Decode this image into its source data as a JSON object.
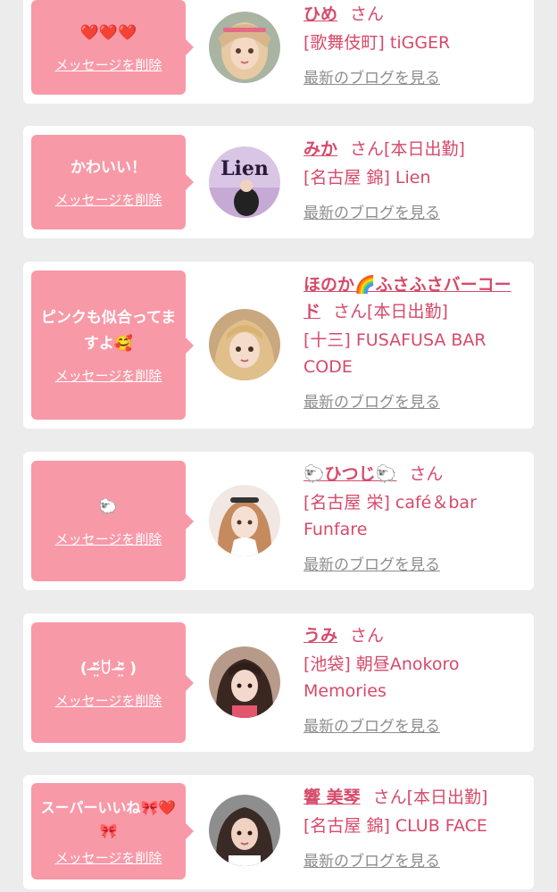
{
  "delete_label": "メッセージを削除",
  "blog_label": "最新のブログを見る",
  "honorific": "さん",
  "cards": [
    {
      "message": "❤️❤️❤️",
      "name": "ひめ",
      "status": "",
      "shop": "[歌舞伎町] tiGGER",
      "avatar_icon": "girl-portrait"
    },
    {
      "message": "かわいい！",
      "name": "みか",
      "status": "[本日出勤]",
      "shop": "[名古屋 錦] Lien",
      "avatar_icon": "lien-logo-portrait"
    },
    {
      "message": "ピンクも似合ってますよ🥰",
      "name": "ほのか🌈ふさふさバーコード",
      "status": "[本日出勤]",
      "shop": "[十三] FUSAFUSA BAR CODE",
      "avatar_icon": "girl-portrait"
    },
    {
      "message": "🐑",
      "name": "🐑ひつじ🐑",
      "status": "",
      "shop": "[名古屋 栄] café＆bar Funfare",
      "avatar_icon": "girl-portrait"
    },
    {
      "message": "( ᵔ̴̶̤᷄ꇴ ᵔ̴̶̤᷅ )",
      "name": "うみ",
      "status": "",
      "shop": "[池袋] 朝昼Anokoro Memories",
      "avatar_icon": "girl-portrait"
    },
    {
      "message": "スーパーいいね🎀❤️🎀",
      "name": "響 美琴",
      "status": "[本日出勤]",
      "shop": "[名古屋 錦] CLUB FACE",
      "avatar_icon": "girl-portrait"
    }
  ]
}
